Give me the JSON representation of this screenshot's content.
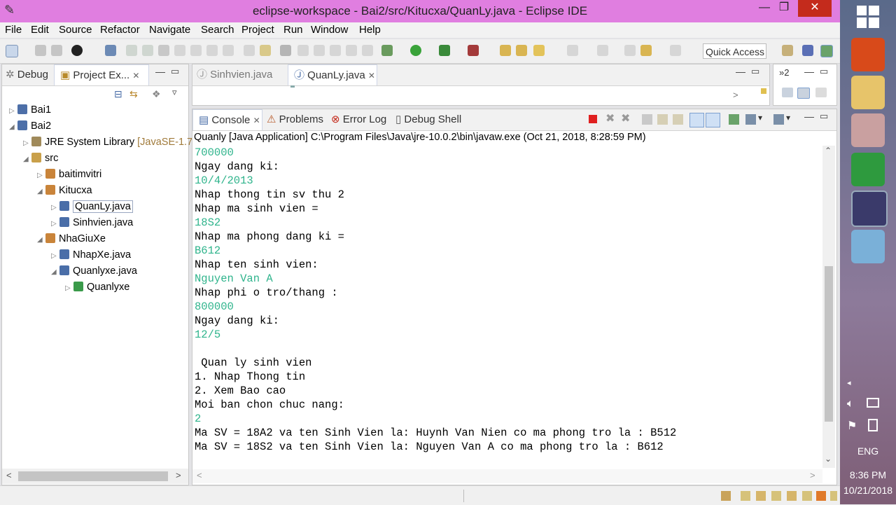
{
  "window": {
    "title": "eclipse-workspace - Bai2/src/Kitucxa/QuanLy.java - Eclipse IDE"
  },
  "menu": [
    "File",
    "Edit",
    "Source",
    "Refactor",
    "Navigate",
    "Search",
    "Project",
    "Run",
    "Window",
    "Help"
  ],
  "toolbar": {
    "quick_access": "Quick Access"
  },
  "left_pane": {
    "tabs": [
      "Debug",
      "Project Ex..."
    ],
    "tree": [
      {
        "label": "Bai1",
        "depth": 0,
        "expanded": false,
        "icon": "project-folder-icon"
      },
      {
        "label": "Bai2",
        "depth": 0,
        "expanded": true,
        "icon": "project-folder-icon"
      },
      {
        "label": "JRE System Library",
        "suffix": "[JavaSE-1.7",
        "depth": 1,
        "expanded": false,
        "icon": "library-icon"
      },
      {
        "label": "src",
        "depth": 1,
        "expanded": true,
        "icon": "source-folder-icon"
      },
      {
        "label": "baitimvitri",
        "depth": 2,
        "expanded": false,
        "icon": "package-icon"
      },
      {
        "label": "Kitucxa",
        "depth": 2,
        "expanded": true,
        "icon": "package-icon"
      },
      {
        "label": "QuanLy.java",
        "depth": 3,
        "expanded": false,
        "icon": "java-file-icon",
        "selected": true
      },
      {
        "label": "Sinhvien.java",
        "depth": 3,
        "expanded": false,
        "icon": "java-file-icon"
      },
      {
        "label": "NhaGiuXe",
        "depth": 2,
        "expanded": true,
        "icon": "package-icon"
      },
      {
        "label": "NhapXe.java",
        "depth": 3,
        "expanded": false,
        "icon": "java-file-icon"
      },
      {
        "label": "Quanlyxe.java",
        "depth": 3,
        "expanded": true,
        "icon": "java-file-icon"
      },
      {
        "label": "Quanlyxe",
        "depth": 4,
        "expanded": false,
        "icon": "class-icon"
      }
    ]
  },
  "editor": {
    "tabs": [
      "Sinhvien.java",
      "QuanLy.java"
    ],
    "overflow": "»2"
  },
  "console": {
    "tabs": [
      "Console",
      "Problems",
      "Error Log",
      "Debug Shell"
    ],
    "header": "Quanly [Java Application] C:\\Program Files\\Java\\jre-10.0.2\\bin\\javaw.exe (Oct 21, 2018, 8:28:59 PM)",
    "lines": [
      {
        "text": "700000",
        "input": true
      },
      {
        "text": "Ngay dang ki:",
        "input": false
      },
      {
        "text": "10/4/2013",
        "input": true
      },
      {
        "text": "Nhap thong tin sv thu 2",
        "input": false
      },
      {
        "text": "Nhap ma sinh vien =",
        "input": false
      },
      {
        "text": "18S2",
        "input": true
      },
      {
        "text": "Nhap ma phong dang ki =",
        "input": false
      },
      {
        "text": "B612",
        "input": true
      },
      {
        "text": "Nhap ten sinh vien:",
        "input": false
      },
      {
        "text": "Nguyen Van A",
        "input": true
      },
      {
        "text": "Nhap phi o tro/thang :",
        "input": false
      },
      {
        "text": "800000",
        "input": true
      },
      {
        "text": "Ngay dang ki:",
        "input": false
      },
      {
        "text": "12/5",
        "input": true
      },
      {
        "text": "",
        "input": false
      },
      {
        "text": " Quan ly sinh vien",
        "input": false
      },
      {
        "text": "1. Nhap Thong tin",
        "input": false
      },
      {
        "text": "2. Xem Bao cao",
        "input": false
      },
      {
        "text": "Moi ban chon chuc nang:",
        "input": false
      },
      {
        "text": "2",
        "input": true
      },
      {
        "text": "Ma SV = 18A2 va ten Sinh Vien la: Huynh Van Nien co ma phong tro la : B512",
        "input": false
      },
      {
        "text": "Ma SV = 18S2 va ten Sinh Vien la: Nguyen Van A co ma phong tro la : B612",
        "input": false
      }
    ]
  },
  "taskbar": {
    "language": "ENG",
    "time": "8:36 PM",
    "date": "10/21/2018"
  },
  "colors": {
    "title_bar": "#e07ee0",
    "input_text": "#2fb48c",
    "close_button": "#c42b1c"
  }
}
